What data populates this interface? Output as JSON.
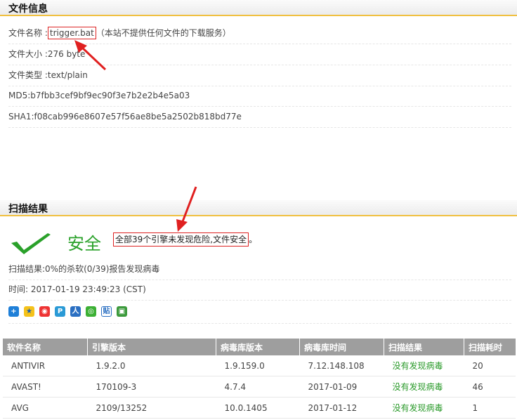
{
  "file_info": {
    "heading": "文件信息",
    "name_label": "文件名称 :",
    "name_value": "trigger.bat",
    "name_note": "（本站不提供任何文件的下载服务）",
    "size": "文件大小 :276 byte",
    "type": "文件类型 :text/plain",
    "md5": "MD5:b7fbb3cef9bf9ec90f3e7b2e2b4e5a03",
    "sha1": "SHA1:f08cab996e8607e57f56ae8be5a2502b818bd77e"
  },
  "scan": {
    "heading": "扫描结果",
    "safe_label": "安全",
    "safe_message": "全部39个引擎未发现危险,文件安全",
    "safe_message_end": "。",
    "result": "扫描结果:0%的杀软(0/39)报告发现病毒",
    "time": "时间: 2017-01-19 23:49:23 (CST)"
  },
  "share_icons": [
    "plus-icon",
    "qzone-icon",
    "weibo-icon",
    "tencent-weibo-icon",
    "renren-icon",
    "wechat-icon",
    "tieba-icon",
    "douban-icon"
  ],
  "table": {
    "headers": [
      "软件名称",
      "引擎版本",
      "病毒库版本",
      "病毒库时间",
      "扫描结果",
      "扫描耗时"
    ],
    "rows": [
      [
        "ANTIVIR",
        "1.9.2.0",
        "1.9.159.0",
        "7.12.148.108",
        "没有发现病毒",
        "20"
      ],
      [
        "AVAST!",
        "170109-3",
        "4.7.4",
        "2017-01-09",
        "没有发现病毒",
        "46"
      ],
      [
        "AVG",
        "2109/13252",
        "10.0.1405",
        "2017-01-12",
        "没有发现病毒",
        "1"
      ]
    ]
  },
  "colors": {
    "safe_green": "#2aa12a",
    "accent": "#f0c040",
    "highlight_box": "#dd2222"
  }
}
